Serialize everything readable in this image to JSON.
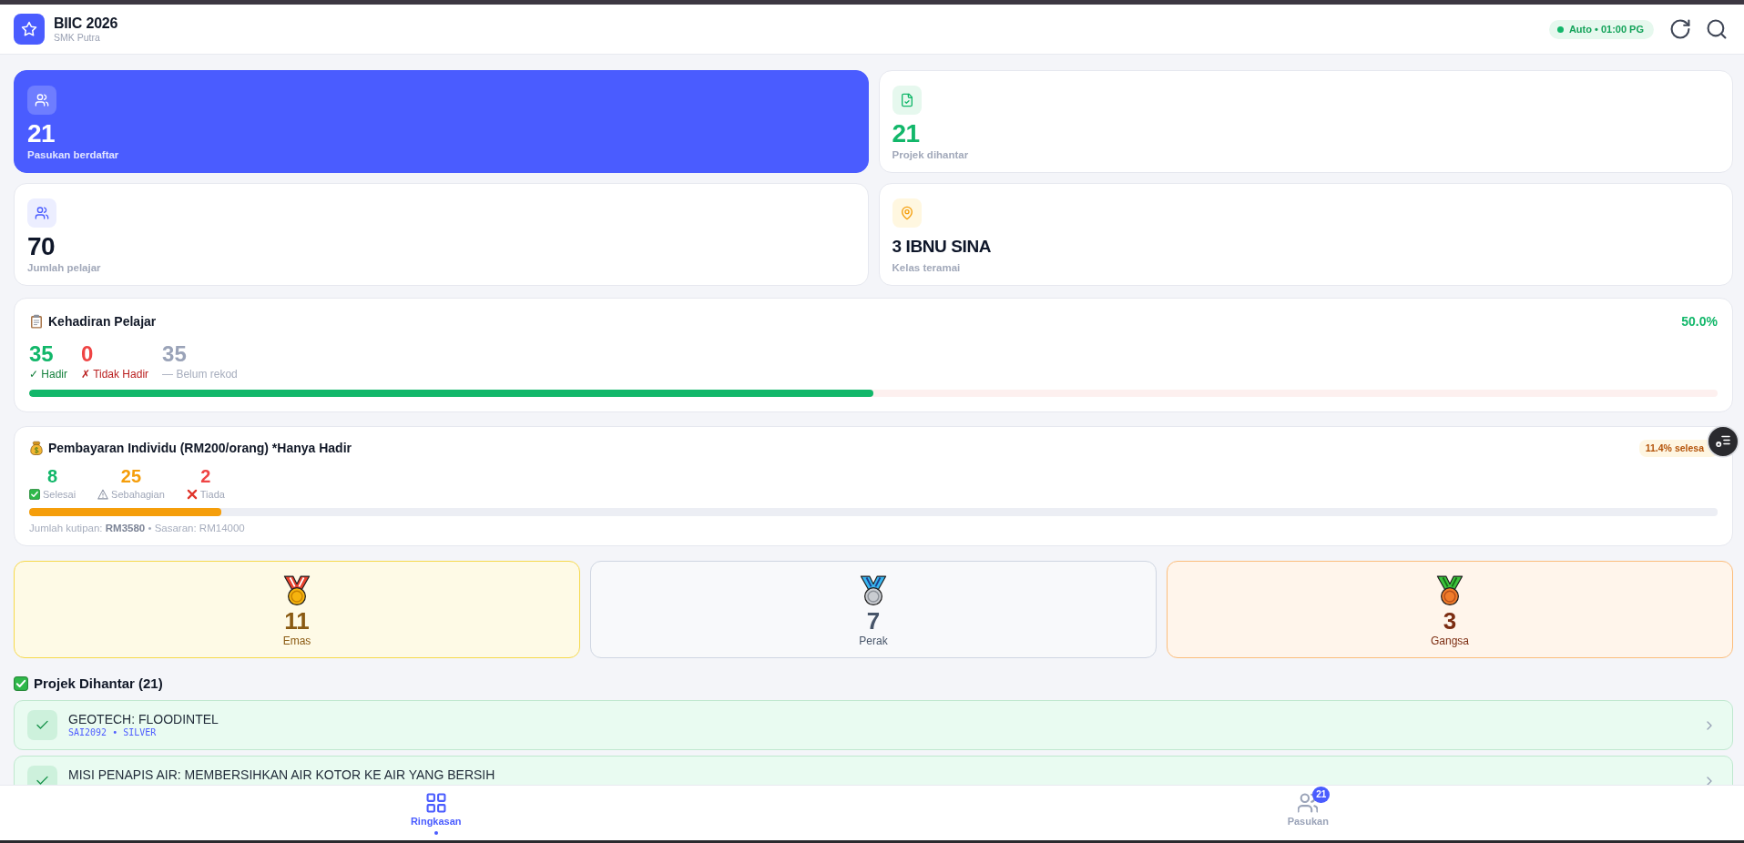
{
  "header": {
    "title": "BIIC 2026",
    "subtitle": "SMK Putra",
    "auto_refresh": {
      "label": "Auto • 01:00 PG",
      "on": true
    }
  },
  "stats": [
    {
      "kind": "teams",
      "value": "21",
      "label": "Pasukan berdaftar"
    },
    {
      "kind": "projects",
      "value": "21",
      "label": "Projek dihantar"
    },
    {
      "kind": "students",
      "value": "70",
      "label": "Jumlah pelajar"
    },
    {
      "kind": "classroom",
      "value": "3 IBNU SINA",
      "label": "Kelas teramai"
    }
  ],
  "attendance": {
    "title": "Kehadiran Pelajar",
    "percent": "50.0%",
    "counts": [
      {
        "kind": "present",
        "value": "35",
        "label": "✓ Hadir"
      },
      {
        "kind": "absent",
        "value": "0",
        "label": "✗ Tidak Hadir"
      },
      {
        "kind": "pending",
        "value": "35",
        "label": "— Belum rekod"
      }
    ],
    "level": 0.5
  },
  "payment": {
    "title": "Pembayaran Individu (RM200/orang) *Hanya Hadir",
    "badge": "11.4% selesa",
    "counts": [
      {
        "kind": "done",
        "value": "8",
        "label": "Selesai"
      },
      {
        "kind": "partial",
        "value": "25",
        "label": "Sebahagian"
      },
      {
        "kind": "none",
        "value": "2",
        "label": "Tiada"
      }
    ],
    "level": 0.114,
    "summary": "Jumlah kutipan: **RM3580** • Sasaran: RM14000"
  },
  "medals": [
    {
      "kind": "gold",
      "count": "11",
      "label": "Emas"
    },
    {
      "kind": "silver",
      "count": "7",
      "label": "Perak"
    },
    {
      "kind": "bronze",
      "count": "3",
      "label": "Gangsa"
    }
  ],
  "projects": {
    "title": "Projek Dihantar (21)",
    "items": [
      {
        "title": "GEOTECH: FLOODINTEL",
        "code": "SAI2092 • SILVER"
      },
      {
        "title": "MISI PENAPIS AIR: MEMBERSIHKAN AIR KOTOR KE AIR YANG BERSIH"
      }
    ]
  },
  "nav": [
    {
      "kind": "summary",
      "label": "Ringkasan",
      "selected": true
    },
    {
      "kind": "teams",
      "label": "Pasukan",
      "selected": false,
      "badge": "21"
    }
  ]
}
